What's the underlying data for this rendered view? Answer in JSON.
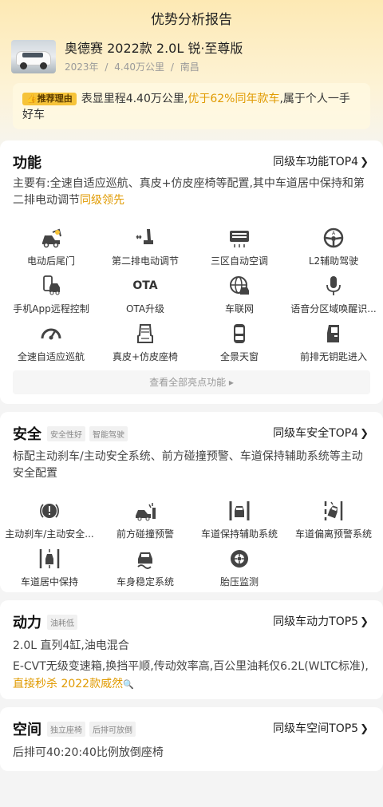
{
  "header": {
    "title": "优势分析报告"
  },
  "car": {
    "name": "奥德赛 2022款 2.0L 锐·至尊版",
    "year": "2023年",
    "mileage": "4.40万公里",
    "city": "南昌",
    "sep": "/"
  },
  "reason": {
    "badge": "推荐理由",
    "text_before": "表显里程4.40万公里,",
    "highlight": "优于62%同年款车",
    "text_after": ",属于个人一手好车"
  },
  "function_section": {
    "title": "功能",
    "top_link": "同级车功能TOP4",
    "summary": "主要有:全速自适应巡航、真皮+仿皮座椅等配置,其中车道居中保持和第二排电动调节",
    "summary_highlight": "同级领先",
    "items": [
      {
        "label": "电动后尾门",
        "icon": "power-tailgate-icon"
      },
      {
        "label": "第二排电动调节",
        "icon": "seat-adjust-icon"
      },
      {
        "label": "三区自动空调",
        "icon": "climate-icon"
      },
      {
        "label": "L2辅助驾驶",
        "icon": "steering-wheel-icon"
      },
      {
        "label": "手机App远程控制",
        "icon": "phone-car-icon"
      },
      {
        "label": "OTA升级",
        "icon": "ota-icon",
        "icon_text": "OTA"
      },
      {
        "label": "车联网",
        "icon": "globe-car-icon"
      },
      {
        "label": "语音分区域唤醒识...",
        "icon": "microphone-icon"
      },
      {
        "label": "全速自适应巡航",
        "icon": "speedometer-icon"
      },
      {
        "label": "真皮+仿皮座椅",
        "icon": "leather-seat-icon"
      },
      {
        "label": "全景天窗",
        "icon": "sunroof-icon"
      },
      {
        "label": "前排无钥匙进入",
        "icon": "keyless-door-icon"
      }
    ],
    "more_label": "查看全部亮点功能 ▸"
  },
  "safety_section": {
    "title": "安全",
    "tags": [
      "安全性好",
      "智能驾驶"
    ],
    "top_link": "同级车安全TOP4",
    "summary": "标配主动刹车/主动安全系统、前方碰撞预警、车道保持辅助系统等主动安全配置",
    "items": [
      {
        "label": "主动刹车/主动安全...",
        "icon": "brake-warning-icon"
      },
      {
        "label": "前方碰撞预警",
        "icon": "collision-warning-icon"
      },
      {
        "label": "车道保持辅助系统",
        "icon": "lane-keep-icon"
      },
      {
        "label": "车道偏离预警系统",
        "icon": "lane-departure-icon"
      },
      {
        "label": "车道居中保持",
        "icon": "lane-center-icon"
      },
      {
        "label": "车身稳定系统",
        "icon": "stability-icon"
      },
      {
        "label": "胎压监测",
        "icon": "tire-pressure-icon"
      }
    ]
  },
  "power_section": {
    "title": "动力",
    "tags": [
      "油耗低"
    ],
    "top_link": "同级车动力TOP5",
    "line1": "2.0L 直列4缸,油电混合",
    "line2": "E-CVT无级变速箱,换挡平顺,传动效率高,百公里油耗仅6.2L(WLTC标准),",
    "line2_highlight": "直接秒杀 2022款威然"
  },
  "space_section": {
    "title": "空间",
    "tags": [
      "独立座椅",
      "后排可放倒"
    ],
    "top_link": "同级车空间TOP5",
    "line1": "后排可40:20:40比例放倒座椅"
  },
  "colors": {
    "accent": "#e09a00",
    "badge": "#f6c339",
    "hero": "#fde9b4"
  }
}
